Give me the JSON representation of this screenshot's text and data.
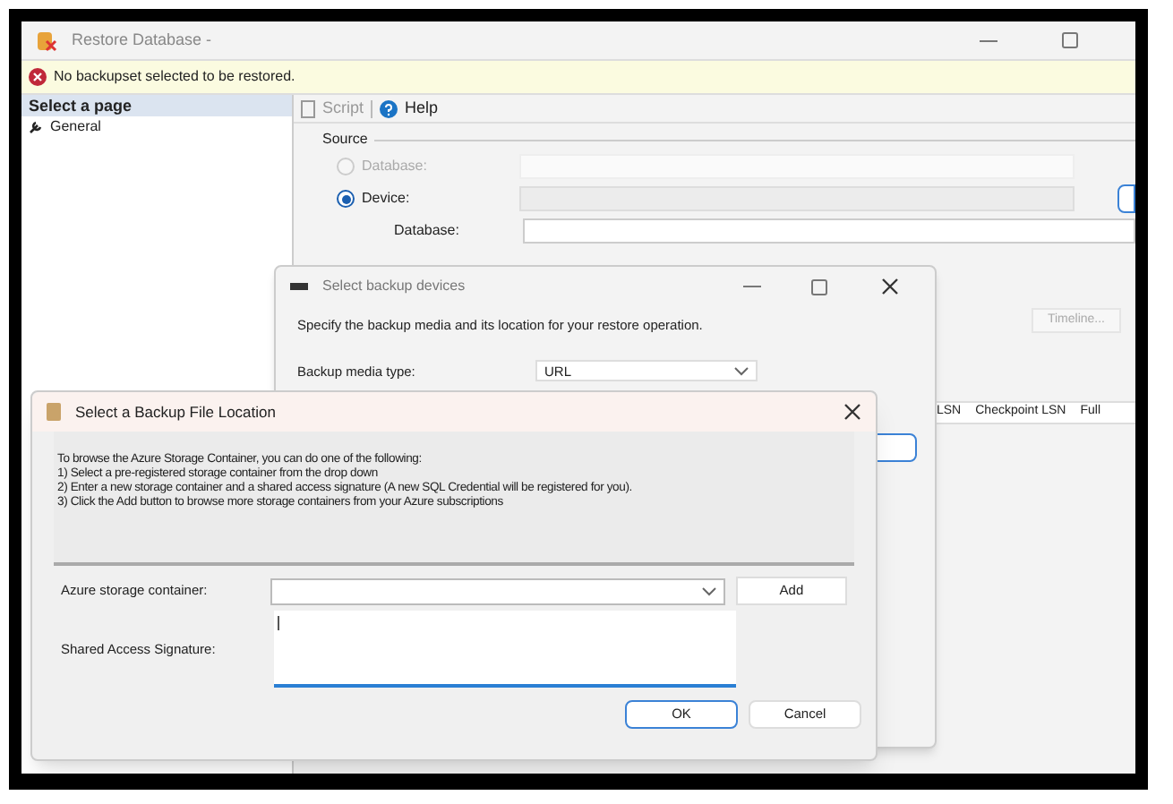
{
  "main_window": {
    "title": "Restore Database -",
    "error": "No backupset selected to be restored.",
    "sidebar_title": "Select a page",
    "sidebar_items": [
      {
        "label": "General",
        "selected": false
      }
    ],
    "toolbar": {
      "script": "Script",
      "help": "Help"
    },
    "source": {
      "label": "Source",
      "options": [
        {
          "label": "Database:",
          "selected": false,
          "disabled": true
        },
        {
          "label": "Device:",
          "selected": true,
          "disabled": false
        }
      ],
      "database_label": "Database:"
    },
    "timeline": "Timeline...",
    "columns": [
      "LSN",
      "Checkpoint LSN",
      "Full"
    ]
  },
  "devices_dialog": {
    "title": "Select backup devices",
    "description": "Specify the backup media and its location for your restore operation.",
    "media_type_label": "Backup media type:",
    "media_type": "URL"
  },
  "file_dialog": {
    "title": "Select a Backup File Location",
    "instructions": [
      "To browse the Azure Storage Container, you can do one of the following:",
      "1) Select a pre-registered storage container from the drop down",
      "2) Enter a new storage container and a shared access signature (A new SQL Credential will be registered for you).",
      "3) Click the Add button to browse more storage containers from your Azure subscriptions"
    ],
    "container_label": "Azure storage container:",
    "add": "Add",
    "signature_label": "Shared Access Signature:",
    "ok": "OK",
    "cancel": "Cancel"
  }
}
